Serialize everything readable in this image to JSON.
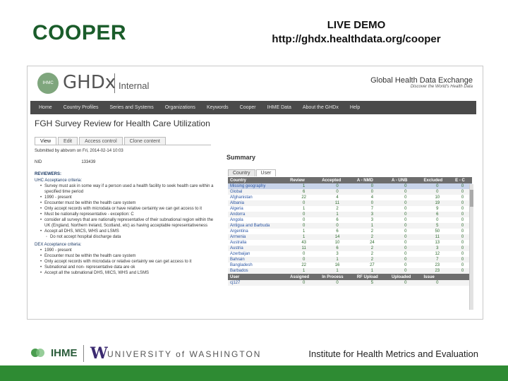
{
  "slide": {
    "title": "COOPER",
    "live_demo": "LIVE DEMO",
    "url": "http://ghdx.healthdata.org/cooper"
  },
  "app": {
    "badge": "IHMC",
    "logo": "GHDx",
    "logo_sub": "Internal",
    "site_name": "Global Health Data Exchange",
    "tagline": "Discover the World's Health Data"
  },
  "nav": [
    "Home",
    "Country Profiles",
    "Series and Systems",
    "Organizations",
    "Keywords",
    "Cooper",
    "IHME Data",
    "About the GHDx",
    "Help"
  ],
  "page": {
    "title": "FGH Survey Review for Health Care Utilization",
    "tabs": [
      "View",
      "Edit",
      "Access control",
      "Clone content"
    ],
    "submitted": "Submitted by abbvom on Fri, 2014-02-14 10:03",
    "nid_label": "NID",
    "nid_value": "133439",
    "reviewers_label": "REVIEWERS:",
    "uhc_title": "UHC Acceptance criteria:",
    "uhc_bullets": [
      {
        "text": "Survey must ask in some way if a person used a health facility to seek health care within a specified time period",
        "sub": false
      },
      {
        "text": "1990 - present",
        "sub": false
      },
      {
        "text": "Encounter must be within the health care system",
        "sub": false
      },
      {
        "text": "Only accept records with microdata or have relative certainty we can get access to it",
        "sub": false
      },
      {
        "text": "Must be nationally representative - exception: C",
        "sub": false
      },
      {
        "text": "consider all surveys that are nationally representative of their subnational region within the UK (England, Northern Ireland, Scotland, etc) as having acceptable representativeness",
        "sub": false
      },
      {
        "text": "Accept all DHS, MICS, WHS and LSMS",
        "sub": false
      },
      {
        "text": "Do not accept hospital discharge data",
        "sub": true
      }
    ],
    "dex_title": "DEX Acceptance criteria:",
    "dex_bullets": [
      {
        "text": "1990 - present",
        "sub": false
      },
      {
        "text": "Encounter must be within the health care system",
        "sub": false
      },
      {
        "text": "Only accept records with microdata or relative certainty we can get access to it",
        "sub": false
      },
      {
        "text": "Subnational and non- representative data are ok",
        "sub": false
      },
      {
        "text": "Accept all the subnational DHS, MICS, WHS and LSMS",
        "sub": false
      }
    ]
  },
  "summary": {
    "title": "Summary",
    "tabs": [
      "Country",
      "User"
    ],
    "columns": [
      "Country",
      "Review",
      "Accepted",
      "A - NMD",
      "A - UNB",
      "Excluded",
      "E - C"
    ],
    "rows": [
      {
        "name": "Missing geography",
        "review": "1",
        "accepted": "0",
        "a_nmd": "0",
        "a_unb": "0",
        "excluded": "0",
        "e_c": "0",
        "hl": true
      },
      {
        "name": "Global",
        "review": "6",
        "accepted": "0",
        "a_nmd": "0",
        "a_unb": "0",
        "excluded": "0",
        "e_c": "0",
        "hl": false
      },
      {
        "name": "Afghanistan",
        "review": "22",
        "accepted": "4",
        "a_nmd": "4",
        "a_unb": "0",
        "excluded": "10",
        "e_c": "0",
        "hl": false
      },
      {
        "name": "Albania",
        "review": "0",
        "accepted": "11",
        "a_nmd": "0",
        "a_unb": "0",
        "excluded": "19",
        "e_c": "0",
        "hl": false
      },
      {
        "name": "Algeria",
        "review": "1",
        "accepted": "2",
        "a_nmd": "7",
        "a_unb": "0",
        "excluded": "9",
        "e_c": "0",
        "hl": false
      },
      {
        "name": "Andorra",
        "review": "0",
        "accepted": "1",
        "a_nmd": "3",
        "a_unb": "0",
        "excluded": "6",
        "e_c": "0",
        "hl": false
      },
      {
        "name": "Angola",
        "review": "0",
        "accepted": "6",
        "a_nmd": "3",
        "a_unb": "0",
        "excluded": "0",
        "e_c": "0",
        "hl": false
      },
      {
        "name": "Antigua and Barbuda",
        "review": "0",
        "accepted": "0",
        "a_nmd": "1",
        "a_unb": "0",
        "excluded": "5",
        "e_c": "0",
        "hl": false
      },
      {
        "name": "Argentina",
        "review": "1",
        "accepted": "6",
        "a_nmd": "2",
        "a_unb": "0",
        "excluded": "50",
        "e_c": "0",
        "hl": false
      },
      {
        "name": "Armenia",
        "review": "1",
        "accepted": "14",
        "a_nmd": "2",
        "a_unb": "0",
        "excluded": "11",
        "e_c": "0",
        "hl": false
      },
      {
        "name": "Australia",
        "review": "43",
        "accepted": "10",
        "a_nmd": "24",
        "a_unb": "0",
        "excluded": "13",
        "e_c": "0",
        "hl": false
      },
      {
        "name": "Austria",
        "review": "11",
        "accepted": "6",
        "a_nmd": "2",
        "a_unb": "0",
        "excluded": "3",
        "e_c": "0",
        "hl": false
      },
      {
        "name": "Azerbaijan",
        "review": "0",
        "accepted": "3",
        "a_nmd": "2",
        "a_unb": "0",
        "excluded": "12",
        "e_c": "0",
        "hl": false
      },
      {
        "name": "Bahrain",
        "review": "0",
        "accepted": "1",
        "a_nmd": "2",
        "a_unb": "0",
        "excluded": "7",
        "e_c": "0",
        "hl": false
      },
      {
        "name": "Bangladesh",
        "review": "22",
        "accepted": "16",
        "a_nmd": "27",
        "a_unb": "0",
        "excluded": "23",
        "e_c": "0",
        "hl": false
      },
      {
        "name": "Barbados",
        "review": "1",
        "accepted": "1",
        "a_nmd": "1",
        "a_unb": "0",
        "excluded": "23",
        "e_c": "0",
        "hl": false
      }
    ],
    "user_columns": [
      "User",
      "Assigned",
      "In Process",
      "RF Upload",
      "Uploaded",
      "Issue"
    ],
    "user_rows": [
      {
        "name": "cj127",
        "assigned": "0",
        "in_process": "0",
        "rf_upload": "5",
        "uploaded": "0",
        "issue": "0"
      }
    ]
  },
  "footer": {
    "ihme": "IHME",
    "uw_letter": "W",
    "uw_text": "UNIVERSITY of WASHINGTON",
    "institute": "Institute for Health Metrics and Evaluation"
  },
  "colors": {
    "title_green": "#1a5c2a",
    "band_green": "#2e8b33",
    "nav_bg": "#4a4a4a",
    "highlight_row": "#c8d4ea"
  }
}
